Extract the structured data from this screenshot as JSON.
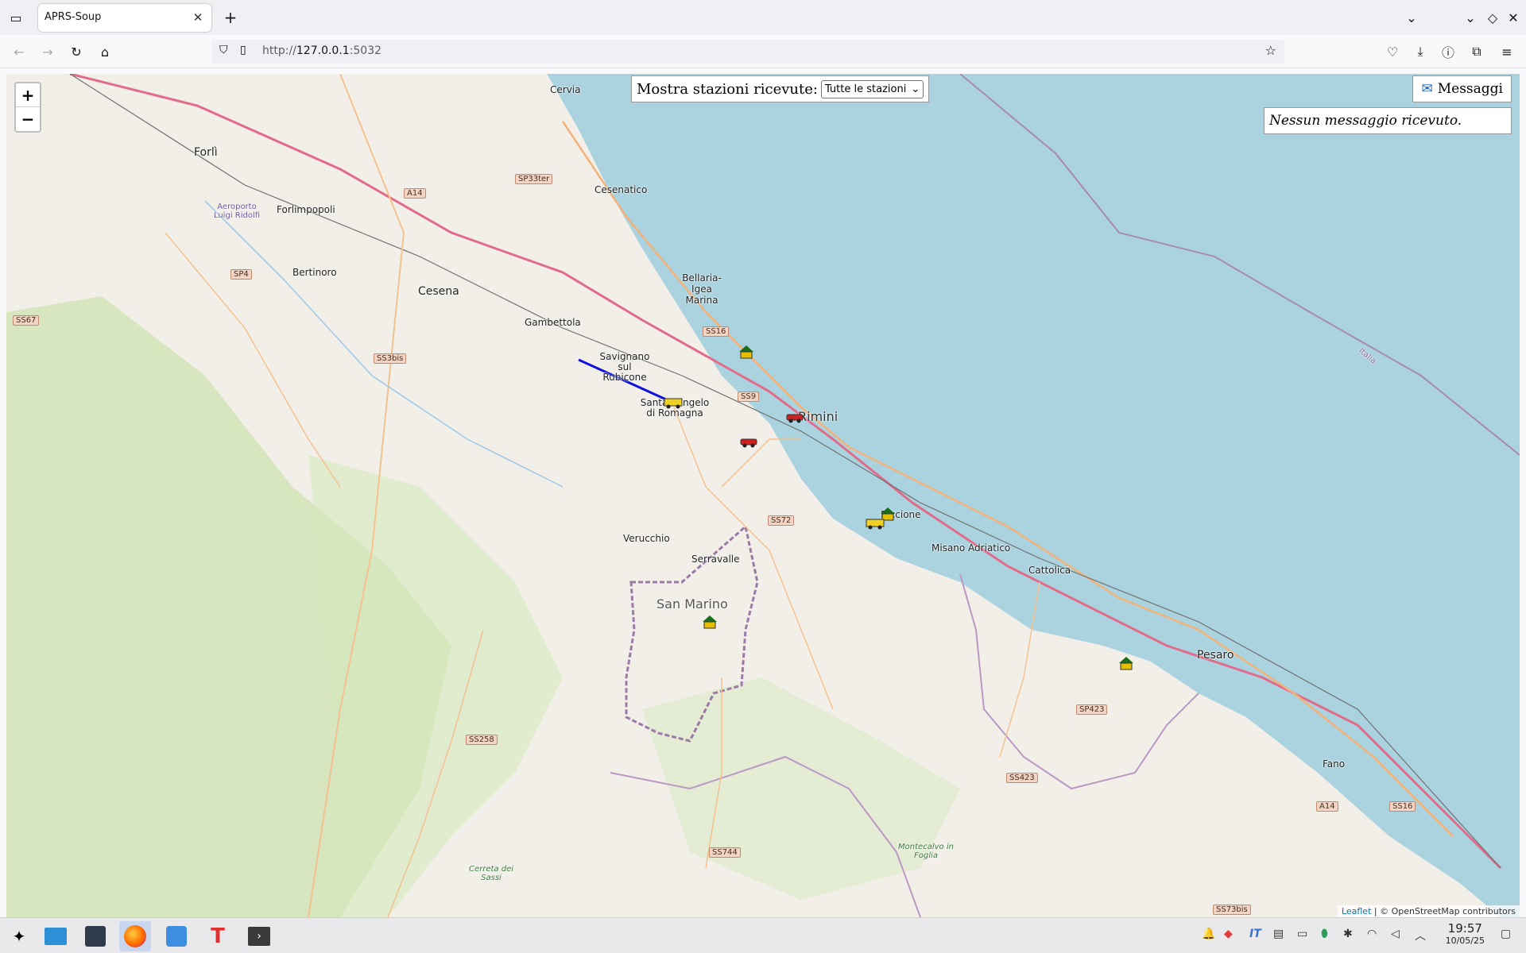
{
  "browser": {
    "tab_title": "APRS-Soup",
    "url_prefix": "http://",
    "url_host": "127.0.0.1",
    "url_suffix": ":5032"
  },
  "map": {
    "filter_label": "Mostra stazioni ricevute:",
    "filter_selected": "Tutte le stazioni",
    "messages_button": "Messaggi",
    "messages_status": "Nessun messaggio ricevuto.",
    "zoom_in": "+",
    "zoom_out": "−",
    "attribution_leaflet": "Leaflet",
    "attribution_osm": "| © OpenStreetMap contributors",
    "places": [
      {
        "name": "Cervia"
      },
      {
        "name": "Forlì"
      },
      {
        "name": "Cesenatico"
      },
      {
        "name": "Forlimpopoli"
      },
      {
        "name": "Aeroporto Luigi Ridolfi"
      },
      {
        "name": "Bertinoro"
      },
      {
        "name": "Cesena"
      },
      {
        "name": "Bellaria-Igea Marina"
      },
      {
        "name": "Gambettola"
      },
      {
        "name": "Savignano sul Rubicone"
      },
      {
        "name": "Santarcangelo di Romagna"
      },
      {
        "name": "Rimini"
      },
      {
        "name": "Riccione"
      },
      {
        "name": "Verucchio"
      },
      {
        "name": "Serravalle"
      },
      {
        "name": "San Marino"
      },
      {
        "name": "Misano Adriatico"
      },
      {
        "name": "Cattolica"
      },
      {
        "name": "Pesaro"
      },
      {
        "name": "Fano"
      },
      {
        "name": "Montecalvo in Foglia"
      },
      {
        "name": "Cerreta dei Sassi"
      },
      {
        "name": "Italia"
      }
    ],
    "roads": [
      "A14",
      "SP33ter",
      "SP4",
      "SS67",
      "SS3bis",
      "SS16",
      "SS9",
      "SS72",
      "SS258",
      "SS744",
      "SP423",
      "SS423",
      "A14",
      "SS16",
      "SS73bis"
    ]
  },
  "taskbar": {
    "tray_lang": "IT",
    "time": "19:57",
    "date": "10/05/25"
  }
}
